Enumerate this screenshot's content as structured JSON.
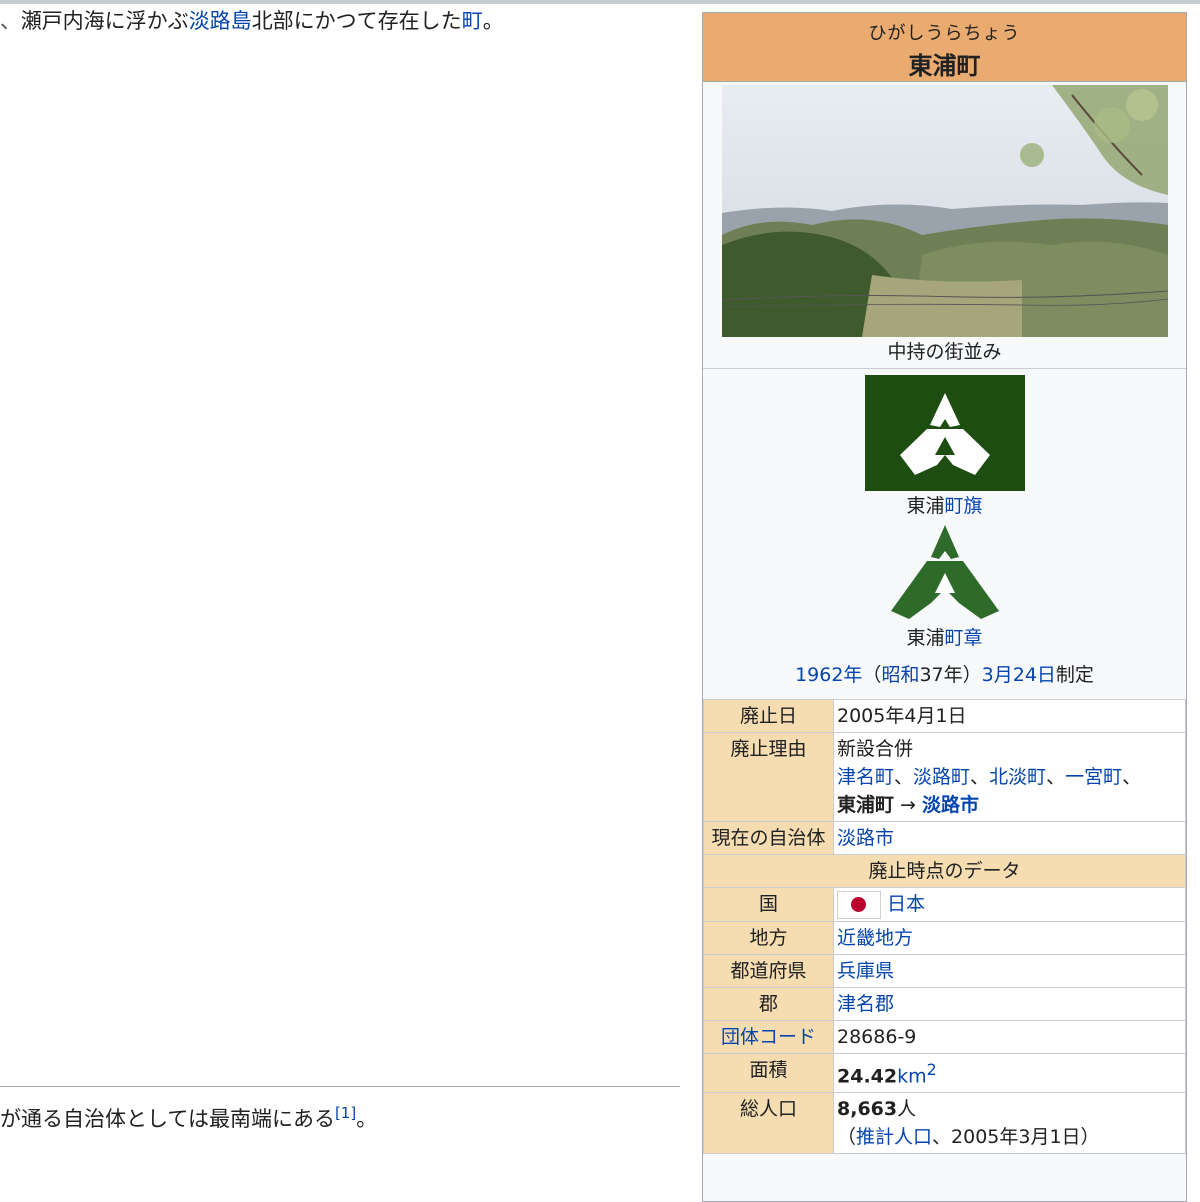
{
  "intro": {
    "lead_char": "、",
    "part1": "瀬戸内海に浮かぶ",
    "link_awaji": "淡路島",
    "part2": "北部にかつて存在した",
    "link_town": "町",
    "part3": "。"
  },
  "para2": {
    "text": "が通る自治体としては最南端にある",
    "ref": "[1]",
    "end": "。"
  },
  "infobox": {
    "kana": "ひがしうらちょう",
    "name": "東浦町",
    "photo_caption": "中持の街並み",
    "flag_caption_prefix": "東浦",
    "flag_caption_link": "町旗",
    "emblem_caption_prefix": "東浦",
    "emblem_caption_link": "町章",
    "date": {
      "year_link": "1962年",
      "paren_open": "（",
      "era_link": "昭和",
      "era_year": "37年）",
      "day_link": "3月24日",
      "suffix": "制定"
    },
    "rows": {
      "abolished_label": "廃止日",
      "abolished_value": "2005年4月1日",
      "reason_label": "廃止理由",
      "reason_type": "新設合併",
      "merge_towns": [
        "津名町",
        "淡路町",
        "北淡町",
        "一宮町"
      ],
      "merge_sep": "、",
      "merge_self": "東浦町",
      "merge_arrow": " → ",
      "merge_result": "淡路市",
      "current_label": "現在の自治体",
      "current_value": "淡路市",
      "section_title": "廃止時点のデータ",
      "country_label": "国",
      "country_value": "日本",
      "region_label": "地方",
      "region_value": "近畿地方",
      "pref_label": "都道府県",
      "pref_value": "兵庫県",
      "district_label": "郡",
      "district_value": "津名郡",
      "code_label": "団体コード",
      "code_value": "28686-9",
      "area_label": "面積",
      "area_value": "24.42",
      "area_unit": "km",
      "area_sup": "2",
      "pop_label": "総人口",
      "pop_value": "8,663",
      "pop_unit": "人",
      "pop_note_open": "（",
      "pop_note_link": "推計人口",
      "pop_note_rest": "、2005年3月1日）"
    }
  },
  "colors": {
    "link": "#0645ad",
    "header_bg": "#eaab71",
    "label_bg": "#f5dcb1",
    "flag_green": "#1e4d12",
    "emblem_green": "#2e6b2a"
  }
}
